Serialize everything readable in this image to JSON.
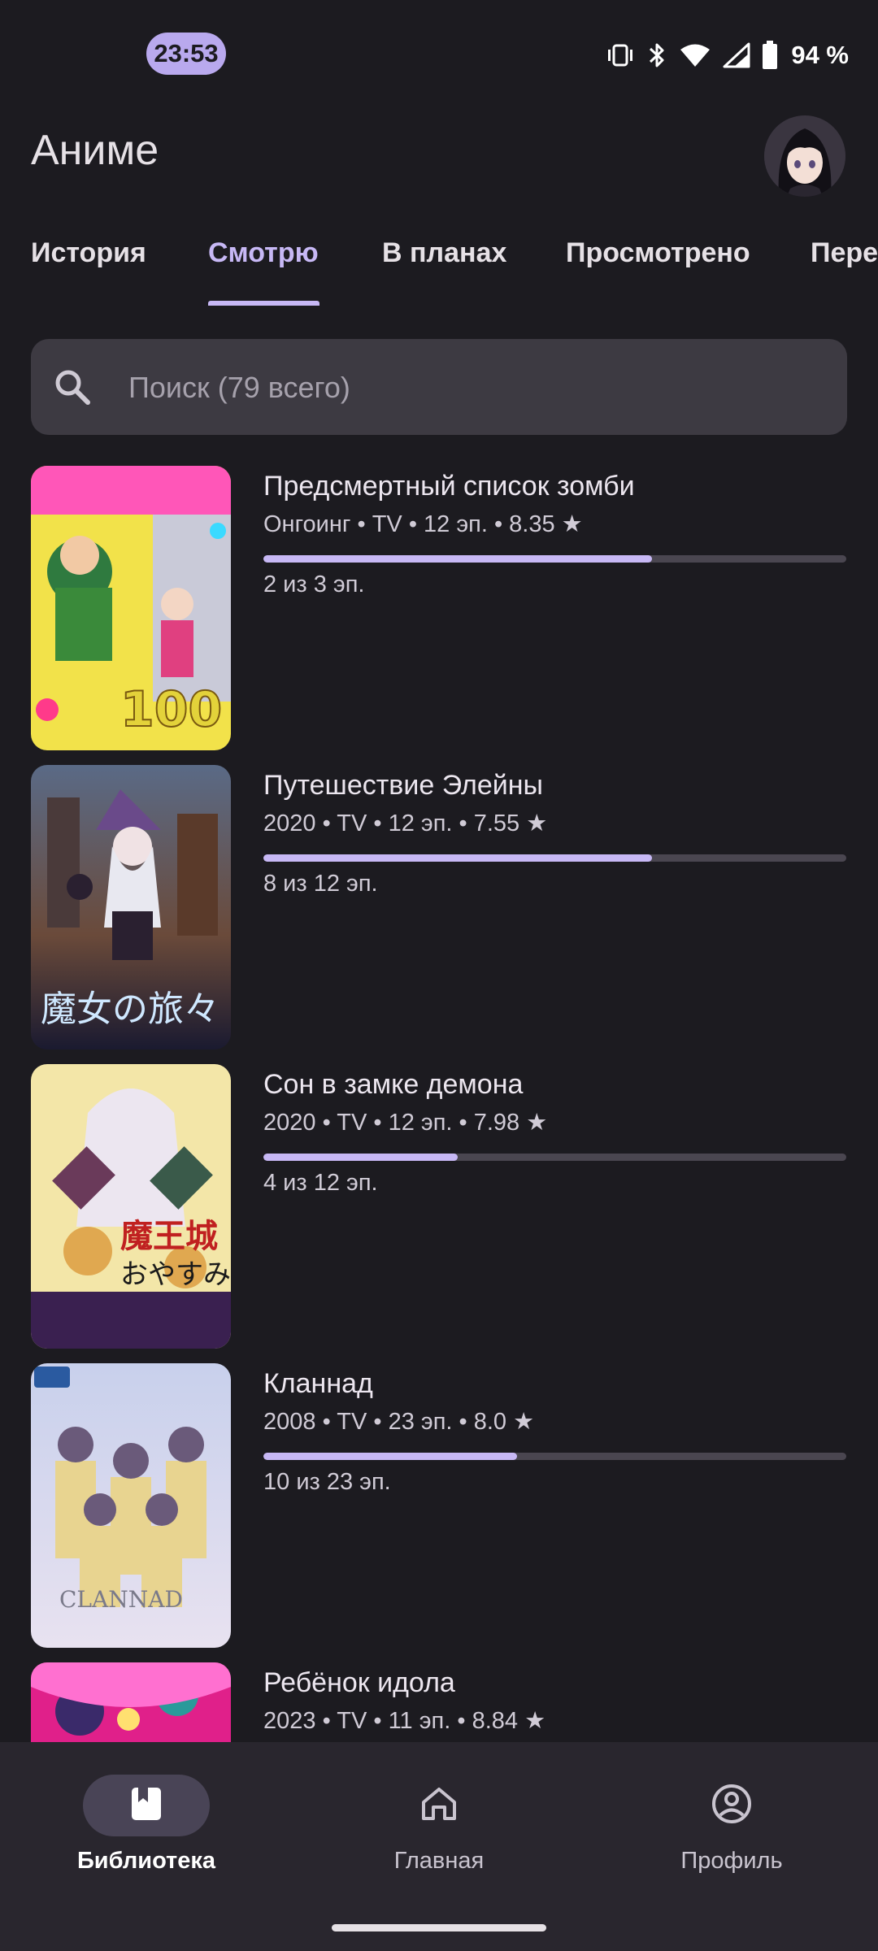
{
  "status_bar": {
    "time": "23:53",
    "battery": "94 %"
  },
  "header": {
    "title": "Аниме"
  },
  "tabs": [
    {
      "label": "История",
      "active": false
    },
    {
      "label": "Смотрю",
      "active": true
    },
    {
      "label": "В планах",
      "active": false
    },
    {
      "label": "Просмотрено",
      "active": false
    },
    {
      "label": "Пере",
      "active": false
    }
  ],
  "search": {
    "placeholder": "Поиск (79 всего)"
  },
  "items": [
    {
      "title": "Предсмертный список зомби",
      "meta": "Онгоинг • TV • 12 эп. • 8.35 ★",
      "progress": 0.667,
      "progress_text": "2 из 3 эп."
    },
    {
      "title": "Путешествие Элейны",
      "meta": "2020 • TV • 12 эп. • 7.55 ★",
      "progress": 0.667,
      "progress_text": "8 из 12 эп."
    },
    {
      "title": "Сон в замке демона",
      "meta": "2020 • TV • 12 эп. • 7.98 ★",
      "progress": 0.333,
      "progress_text": "4 из 12 эп."
    },
    {
      "title": "Кланнад",
      "meta": "2008 • TV • 23 эп. • 8.0 ★",
      "progress": 0.435,
      "progress_text": "10 из 23 эп."
    },
    {
      "title": "Ребёнок идола",
      "meta": "2023 • TV • 11 эп. • 8.84 ★",
      "progress": 0.0,
      "progress_text": ""
    }
  ],
  "bottom_nav": [
    {
      "label": "Библиотека",
      "icon": "library-icon",
      "active": true
    },
    {
      "label": "Главная",
      "icon": "home-icon",
      "active": false
    },
    {
      "label": "Профиль",
      "icon": "profile-icon",
      "active": false
    }
  ],
  "colors": {
    "accent": "#c7b8f5",
    "background": "#1c1b20",
    "surface": "#3d3a42",
    "nav_bg": "#29262e"
  }
}
